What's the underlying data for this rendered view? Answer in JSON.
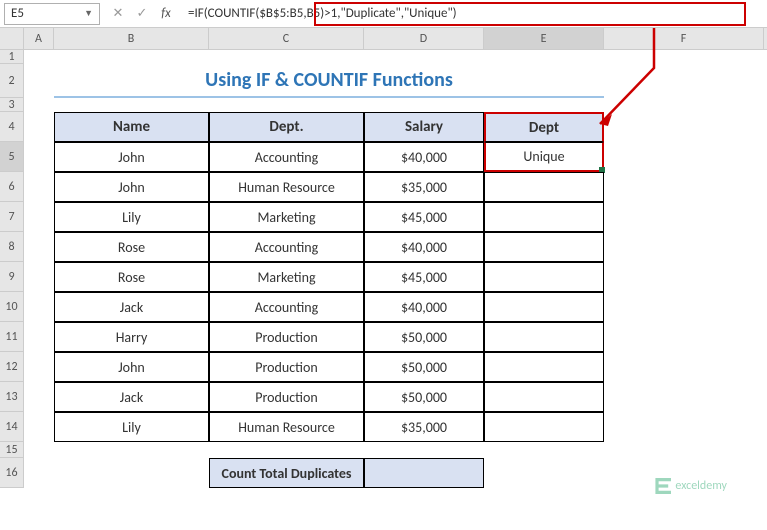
{
  "namebox": {
    "value": "E5"
  },
  "fbar_btns": {
    "cancel": "✕",
    "enter": "✓",
    "fx": "fx"
  },
  "formula": "=IF(COUNTIF($B$5:B5,B5)>1,\"Duplicate\",\"Unique\")",
  "col_headers": {
    "A": "A",
    "B": "B",
    "C": "C",
    "D": "D",
    "E": "E",
    "F": "F"
  },
  "row_headers": [
    "1",
    "2",
    "3",
    "4",
    "5",
    "6",
    "7",
    "8",
    "9",
    "10",
    "11",
    "12",
    "13",
    "14",
    "15",
    "16"
  ],
  "title": "Using IF & COUNTIF Functions",
  "table": {
    "headers": {
      "name": "Name",
      "dept": "Dept.",
      "salary": "Salary",
      "dept2": "Dept"
    },
    "rows": [
      {
        "name": "John",
        "dept": "Accounting",
        "salary": "$40,000",
        "e": "Unique"
      },
      {
        "name": "John",
        "dept": "Human Resource",
        "salary": "$35,000",
        "e": ""
      },
      {
        "name": "Lily",
        "dept": "Marketing",
        "salary": "$45,000",
        "e": ""
      },
      {
        "name": "Rose",
        "dept": "Accounting",
        "salary": "$40,000",
        "e": ""
      },
      {
        "name": "Rose",
        "dept": "Marketing",
        "salary": "$45,000",
        "e": ""
      },
      {
        "name": "Jack",
        "dept": "Accounting",
        "salary": "$40,000",
        "e": ""
      },
      {
        "name": "Harry",
        "dept": "Production",
        "salary": "$50,000",
        "e": ""
      },
      {
        "name": "John",
        "dept": "Production",
        "salary": "$50,000",
        "e": ""
      },
      {
        "name": "Jack",
        "dept": "Production",
        "salary": "$50,000",
        "e": ""
      },
      {
        "name": "Lily",
        "dept": "Human Resource",
        "salary": "$35,000",
        "e": ""
      }
    ]
  },
  "count_dup_label": "Count Total Duplicates",
  "watermark": "exceldemy"
}
